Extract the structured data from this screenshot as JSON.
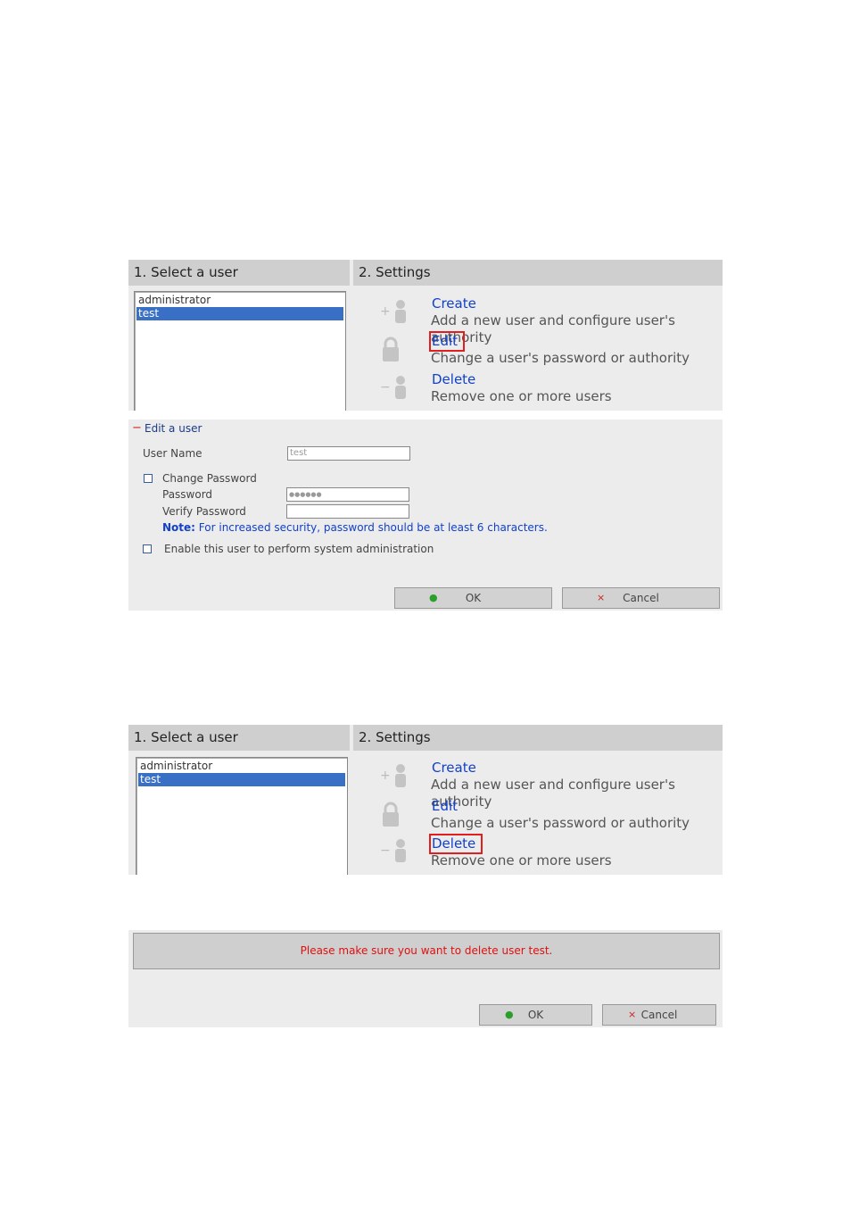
{
  "panel1": {
    "select_header": "1. Select a user",
    "settings_header": "2. Settings",
    "users": [
      "administrator",
      "test"
    ],
    "selected_user": "test",
    "actions": [
      {
        "title": "Create",
        "desc": "Add a new user and configure user's authority",
        "icon": "add-user-icon"
      },
      {
        "title": "Edit",
        "desc": "Change a user's password or authority",
        "icon": "lock-icon"
      },
      {
        "title": "Delete",
        "desc": "Remove one or more users",
        "icon": "remove-user-icon"
      }
    ],
    "highlighted_action": "Edit"
  },
  "edit_form": {
    "toggle": "−",
    "title": "Edit a user",
    "user_name_label": "User Name",
    "user_name_value": "test",
    "change_password_label": "Change Password",
    "password_label": "Password",
    "password_value": "●●●●●●",
    "verify_password_label": "Verify Password",
    "verify_password_value": "",
    "note_prefix": "Note:",
    "note_text": "For increased security, password should be at least 6 characters.",
    "admin_label": "Enable this user to perform system administration",
    "ok_icon": "●",
    "ok_label": "OK",
    "cancel_icon": "×",
    "cancel_label": "Cancel"
  },
  "panel2": {
    "select_header": "1. Select a user",
    "settings_header": "2. Settings",
    "users": [
      "administrator",
      "test"
    ],
    "selected_user": "test",
    "actions": [
      {
        "title": "Create",
        "desc": "Add a new user and configure user's authority",
        "icon": "add-user-icon"
      },
      {
        "title": "Edit",
        "desc": "Change a user's password or authority",
        "icon": "lock-icon"
      },
      {
        "title": "Delete",
        "desc": "Remove one or more users",
        "icon": "remove-user-icon"
      }
    ],
    "highlighted_action": "Delete"
  },
  "confirm": {
    "message": "Please make sure you want to delete user test.",
    "ok_icon": "●",
    "ok_label": "OK",
    "cancel_icon": "×",
    "cancel_label": "Cancel"
  },
  "colors": {
    "link_blue": "#1240c8",
    "highlight_red": "#e02020",
    "selected_row": "#3a6fc6",
    "ok_green": "#2aa02a",
    "cancel_red": "#d02020",
    "warning_red": "#e01010"
  }
}
